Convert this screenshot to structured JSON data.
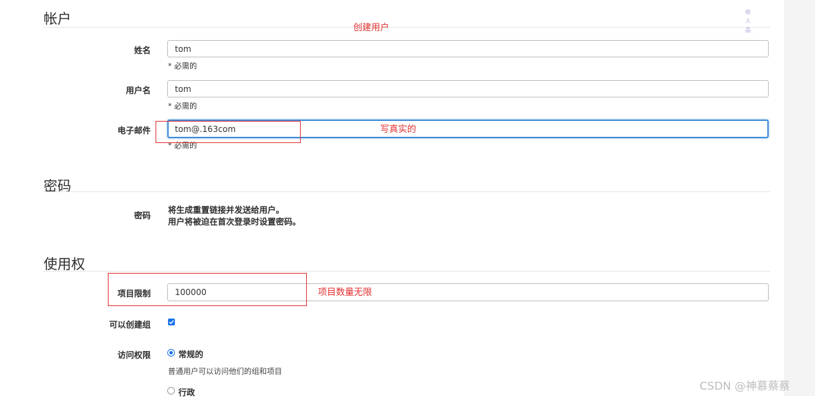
{
  "sections": {
    "account_title": "帐户",
    "password_title": "密码",
    "access_title": "使用权"
  },
  "annotations": {
    "create_user": "创建用户",
    "write_real": "写真实的",
    "unlimited_projects": "项目数量无限"
  },
  "fields": {
    "name": {
      "label": "姓名",
      "value": "tom",
      "help": "* 必需的"
    },
    "username": {
      "label": "用户名",
      "value": "tom",
      "help": "* 必需的"
    },
    "email": {
      "label": "电子邮件",
      "value": "tom@.163com",
      "help": "* 必需的"
    }
  },
  "password": {
    "label": "密码",
    "line1": "将生成重置链接并发送给用户。",
    "line2": "用户将被迫在首次登录时设置密码。"
  },
  "access": {
    "projects_limit_label": "项目限制",
    "projects_limit_value": "100000",
    "can_create_group_label": "可以创建组",
    "can_create_group_checked": true,
    "access_level_label": "访问权限",
    "regular_label": "常规的",
    "regular_help": "普通用户可以访问他们的组和项目",
    "admin_label": "行政"
  },
  "side_icons": [
    "收",
    "人",
    "品"
  ],
  "watermark": "CSDN @神慕蔡蔡",
  "colors": {
    "annotation_red": "#e33030",
    "focus_blue": "#418cd8",
    "check_blue": "#1a73e8"
  }
}
